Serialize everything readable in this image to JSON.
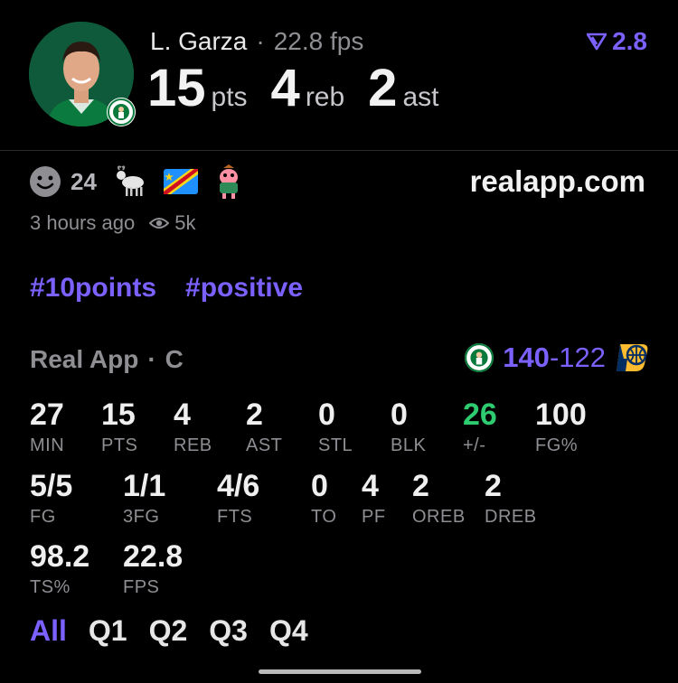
{
  "player": {
    "name": "L. Garza",
    "fps": "22.8 fps",
    "pts": "15",
    "pts_label": "pts",
    "reb": "4",
    "reb_label": "reb",
    "ast": "2",
    "ast_label": "ast"
  },
  "rating": "2.8",
  "reactions": {
    "count": "24"
  },
  "site": "realapp.com",
  "meta": {
    "time": "3 hours ago",
    "views": "5k"
  },
  "tags": [
    "#10points",
    "#positive"
  ],
  "game": {
    "source": "Real App",
    "position": "C",
    "home_score": "140",
    "away_score": "122"
  },
  "stats": [
    {
      "value": "27",
      "label": "MIN"
    },
    {
      "value": "15",
      "label": "PTS"
    },
    {
      "value": "4",
      "label": "REB"
    },
    {
      "value": "2",
      "label": "AST"
    },
    {
      "value": "0",
      "label": "STL"
    },
    {
      "value": "0",
      "label": "BLK"
    },
    {
      "value": "26",
      "label": "+/-",
      "color": "#2ecc71"
    },
    {
      "value": "100",
      "label": "FG%"
    },
    {
      "value": "5/5",
      "label": "FG"
    },
    {
      "value": "1/1",
      "label": "3FG"
    },
    {
      "value": "4/6",
      "label": "FTS"
    },
    {
      "value": "0",
      "label": "TO"
    },
    {
      "value": "4",
      "label": "PF"
    },
    {
      "value": "2",
      "label": "OREB"
    },
    {
      "value": "2",
      "label": "DREB"
    },
    {
      "value": "98.2",
      "label": "TS%"
    },
    {
      "value": "22.8",
      "label": "FPS"
    }
  ],
  "tabs": [
    "All",
    "Q1",
    "Q2",
    "Q3",
    "Q4"
  ],
  "colors": {
    "accent": "#7b61ff",
    "positive": "#2ecc71"
  }
}
